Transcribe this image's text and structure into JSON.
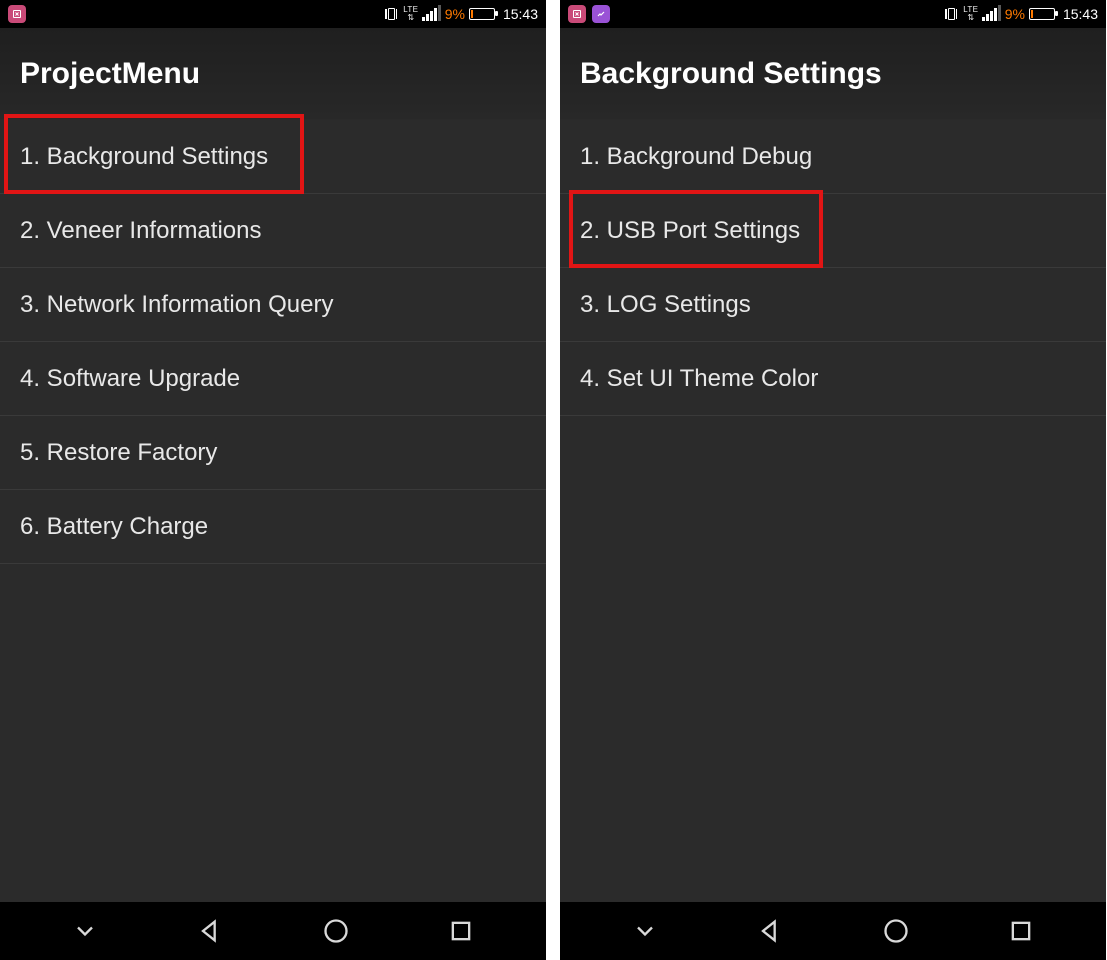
{
  "status": {
    "battery_pct": "9%",
    "clock": "15:43",
    "lte_label": "LTE"
  },
  "left": {
    "title": "ProjectMenu",
    "items": [
      {
        "label": "1. Background Settings"
      },
      {
        "label": "2. Veneer Informations"
      },
      {
        "label": "3. Network Information Query"
      },
      {
        "label": "4. Software Upgrade"
      },
      {
        "label": "5. Restore Factory"
      },
      {
        "label": "6. Battery Charge"
      }
    ],
    "highlight_index": 0
  },
  "right": {
    "title": "Background Settings",
    "items": [
      {
        "label": "1. Background Debug"
      },
      {
        "label": "2. USB Port Settings"
      },
      {
        "label": "3. LOG Settings"
      },
      {
        "label": "4. Set UI Theme Color"
      }
    ],
    "highlight_index": 1
  },
  "colors": {
    "highlight": "#e11515",
    "battery_low": "#ff7a00",
    "bg": "#2b2b2b"
  }
}
